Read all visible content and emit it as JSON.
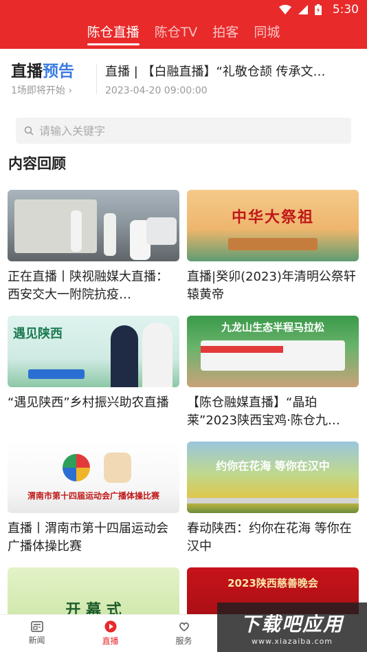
{
  "status_bar": {
    "time": "5:30"
  },
  "top_tabs": [
    {
      "label": "陈仓直播",
      "active": true
    },
    {
      "label": "陈仓TV",
      "active": false
    },
    {
      "label": "拍客",
      "active": false
    },
    {
      "label": "同城",
      "active": false
    }
  ],
  "preview": {
    "title_part1": "直播",
    "title_part2": "预告",
    "subtitle": "1场即将开始",
    "live_title": "直播 | 【白融直播】“礼敬仓颉 传承文…",
    "live_time": "2023-04-20 09:00:00"
  },
  "search": {
    "placeholder": "请输入关键字"
  },
  "section": {
    "title": "内容回顾"
  },
  "cards": [
    {
      "caption": "正在直播丨陕视融媒大直播：西安交大一附院抗疫…",
      "thumb": "covid-checkpoint-photo",
      "overlay": ""
    },
    {
      "caption": "直播|癸卯(2023)年清明公祭轩辕黄帝",
      "thumb": "qingming-ceremony-poster",
      "overlay": "中华大祭祖"
    },
    {
      "caption": "“遇见陕西”乡村振兴助农直播",
      "thumb": "rural-revival-poster",
      "overlay": "遇见陕西"
    },
    {
      "caption": "【陈仓融媒直播】“晶珀莱”2023陕西宝鸡·陈仓九…",
      "thumb": "marathon-truck-photo",
      "overlay": "九龙山生态半程马拉松"
    },
    {
      "caption": "直播丨渭南市第十四届运动会广播体操比赛",
      "thumb": "weinan-games-poster",
      "overlay": "渭南市第十四届运动会广播体操比赛"
    },
    {
      "caption": "春动陕西：约你在花海 等你在汉中",
      "thumb": "hanzhong-flowers-poster",
      "overlay": "约你在花海 等你在汉中"
    },
    {
      "caption": "",
      "thumb": "opening-ceremony-poster",
      "overlay": "开 幕 式"
    },
    {
      "caption": "",
      "thumb": "charity-gala-poster",
      "overlay": "2023陕西慈善晚会"
    }
  ],
  "bottom_nav": [
    {
      "label": "新闻",
      "icon": "news-icon",
      "active": false
    },
    {
      "label": "直播",
      "icon": "play-icon",
      "active": true
    },
    {
      "label": "服务",
      "icon": "service-icon",
      "active": false
    }
  ],
  "watermark": {
    "main": "下载吧应用",
    "url": "www.xiazaiba.com"
  },
  "colors": {
    "brand": "#e82a2a",
    "accent_blue": "#3a7be0"
  }
}
